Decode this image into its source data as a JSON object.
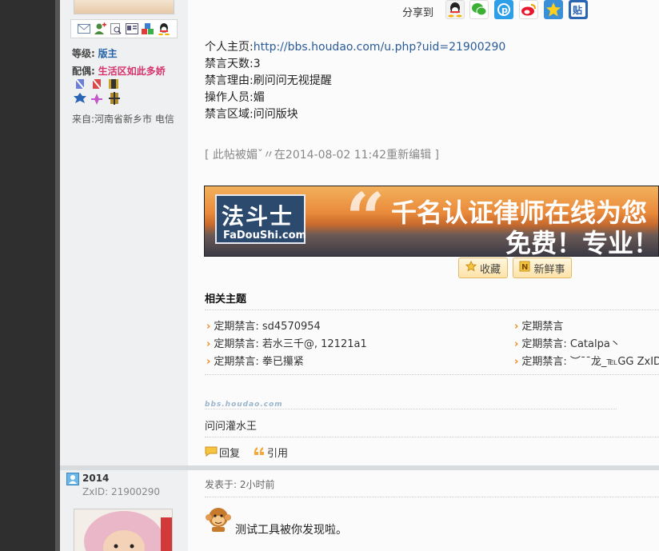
{
  "share": {
    "label": "分享到"
  },
  "sidebar": {
    "level_label": "等级:",
    "level_value": "版主",
    "spouse_label": "配偶:",
    "spouse_value": "生活区如此多娇",
    "location": "来自:河南省新乡市 电信"
  },
  "post": {
    "info": [
      {
        "label": "个人主页:",
        "value": "http://bbs.houdao.com/u.php?uid=21900290",
        "link": true
      },
      {
        "label": "禁言天数:",
        "value": "3"
      },
      {
        "label": "禁言理由:",
        "value": "刷问问无视提醒"
      },
      {
        "label": "操作人员:",
        "value": "媚"
      },
      {
        "label": "禁言区域:",
        "value": "问问版块"
      }
    ],
    "edited": "[ 此帖被媚ˇ〃在2014-08-02 11:42重新编辑 ]"
  },
  "banner": {
    "logo_cn": "法斗士",
    "logo_en": "FaDouShi.com",
    "line1": "千名认证律师在线为您",
    "line2": "免费！专业！"
  },
  "buttons": {
    "favorite": "收藏",
    "news": "新鲜事",
    "reply": "回复",
    "quote": "引用"
  },
  "related": {
    "title": "相关主题",
    "left": [
      "定期禁言: sd4570954",
      "定期禁言: 若水三千@, 12121a1",
      "定期禁言: 拳已攥紧"
    ],
    "right": [
      "定期禁言",
      "定期禁言: Catalpa丶",
      "定期禁言: ︶¯¯龙_℡GG  ZxID"
    ]
  },
  "signature": {
    "watermark": "bbs.houdao.com",
    "text": "问问灌水王"
  },
  "next_post": {
    "username": "2014",
    "zxid": "ZxID: 21900290",
    "posted": "发表于: 2小时前",
    "content": "测试工具被你发现啦。"
  },
  "colors": {
    "link": "#2a5c9a",
    "level": "#2563a8",
    "spouse": "#d6336c",
    "arrow": "#f08a24"
  }
}
